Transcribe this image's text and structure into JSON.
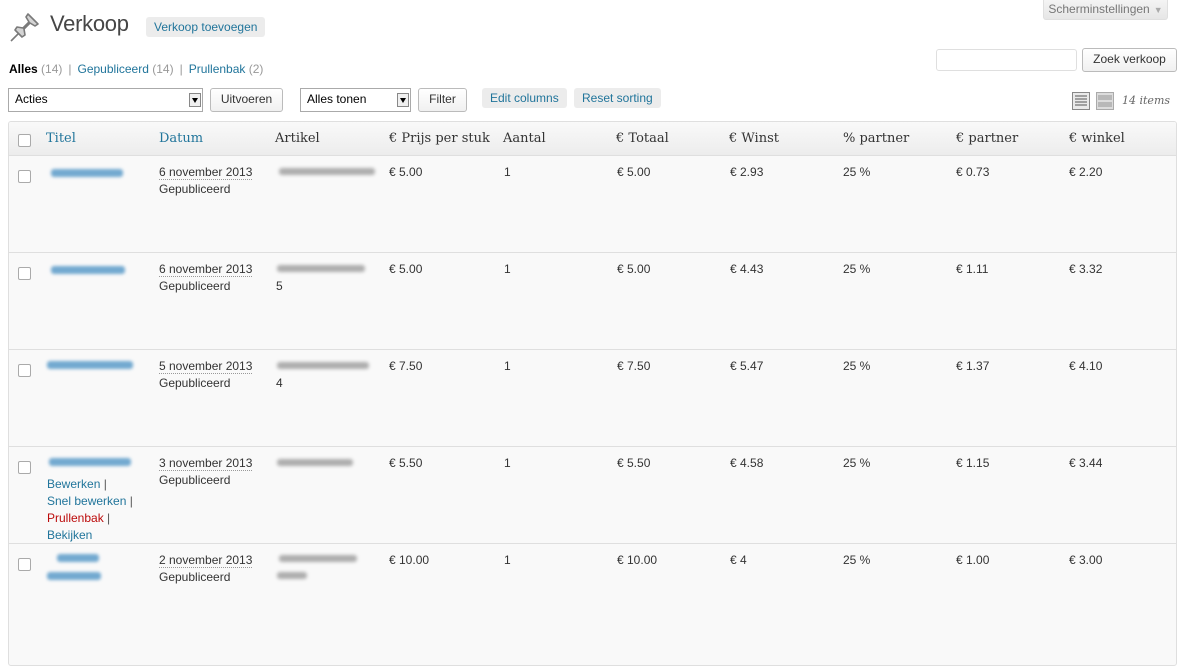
{
  "header": {
    "title": "Verkoop",
    "add_new": "Verkoop toevoegen",
    "screen_options": "Scherminstellingen"
  },
  "views": [
    {
      "label": "Alles",
      "count": "(14)"
    },
    {
      "label": "Gepubliceerd",
      "count": "(14)"
    },
    {
      "label": "Prullenbak",
      "count": "(2)"
    }
  ],
  "search": {
    "placeholder": "",
    "button": "Zoek verkoop"
  },
  "tablenav": {
    "bulk_action": "Acties",
    "apply": "Uitvoeren",
    "filter_select": "Alles tonen",
    "filter_button": "Filter",
    "edit_columns": "Edit columns",
    "reset_sorting": "Reset sorting",
    "items_count": "14 items"
  },
  "columns": [
    "Titel",
    "Datum",
    "Artikel",
    "€ Prijs per stuk",
    "Aantal",
    "€ Totaal",
    "€ Winst",
    "% partner",
    "€ partner",
    "€ winkel"
  ],
  "rows": [
    {
      "date": "6 november 2013",
      "status": "Gepubliceerd",
      "article_extra": "",
      "price": "€ 5.00",
      "qty": "1",
      "total": "€ 5.00",
      "profit": "€ 2.93",
      "pct": "25 %",
      "partner": "€ 0.73",
      "shop": "€ 2.20"
    },
    {
      "date": "6 november 2013",
      "status": "Gepubliceerd",
      "article_extra": "5",
      "price": "€ 5.00",
      "qty": "1",
      "total": "€ 5.00",
      "profit": "€ 4.43",
      "pct": "25 %",
      "partner": "€ 1.11",
      "shop": "€ 3.32"
    },
    {
      "date": "5 november 2013",
      "status": "Gepubliceerd",
      "article_extra": "4",
      "price": "€ 7.50",
      "qty": "1",
      "total": "€ 7.50",
      "profit": "€ 5.47",
      "pct": "25 %",
      "partner": "€ 1.37",
      "shop": "€ 4.10"
    },
    {
      "date": "3 november 2013",
      "status": "Gepubliceerd",
      "article_extra": "",
      "price": "€ 5.50",
      "qty": "1",
      "total": "€ 5.50",
      "profit": "€ 4.58",
      "pct": "25 %",
      "partner": "€ 1.15",
      "shop": "€ 3.44"
    },
    {
      "date": "2 november 2013",
      "status": "Gepubliceerd",
      "article_extra": "",
      "price": "€ 10.00",
      "qty": "1",
      "total": "€ 10.00",
      "profit": "€ 4",
      "pct": "25 %",
      "partner": "€ 1.00",
      "shop": "€ 3.00"
    }
  ],
  "row_actions": {
    "edit": "Bewerken",
    "quick_edit": "Snel bewerken",
    "trash": "Prullenbak",
    "view": "Bekijken",
    "separator": "|"
  }
}
